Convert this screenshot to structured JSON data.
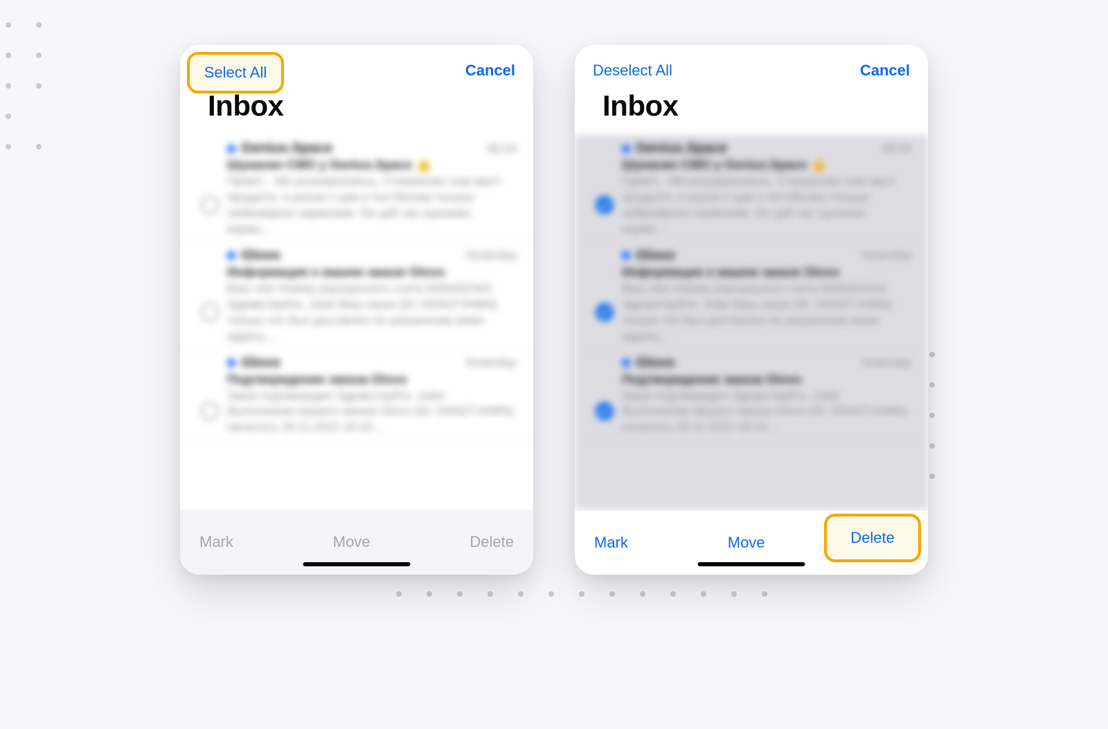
{
  "left": {
    "select_all": "Select All",
    "cancel": "Cancel",
    "title": "Inbox",
    "mark": "Mark",
    "move": "Move",
    "delete": "Delete",
    "emails": [
      {
        "sender": "Genius.Space",
        "time": "08:53",
        "subject": "Шукаємо CMO у Genius.Space 👍",
        "preview": "Привіт, . Ми розширюємось. Створюємо нові круті продукти, а разом з цим у постійному пошуку неймовірних керівників. На цей час шукаємо керівн…"
      },
      {
        "sender": "Glovo",
        "time": "Yesterday",
        "subject": "Информация о вашем заказе Glovo",
        "preview": "Ваш чек! Номер упрощенного счета 5005452343 Здравствуйте, Julia! Ваш заказ (ID: DDNZTJHMN) только что был доставлен по указанному вами адресу…"
      },
      {
        "sender": "Glovo",
        "time": "Yesterday",
        "subject": "Подтверждение заказа Glovo",
        "preview": "Заказ подтвержден Здравствуйте, Julia! Выполнение вашего заказа Glovo (ID: DDNZTJHMN) началось 29.11.2022 18:10…"
      }
    ]
  },
  "right": {
    "deselect_all": "Deselect All",
    "cancel": "Cancel",
    "title": "Inbox",
    "mark": "Mark",
    "move": "Move",
    "delete": "Delete",
    "emails": [
      {
        "sender": "Genius.Space",
        "time": "08:53",
        "subject": "Шукаємо CMO у Genius.Space 👍",
        "preview": "Привіт, . Ми розширюємось. Створюємо нові круті продукти, а разом з цим у постійному пошуку неймовірних керівників. На цей час шукаємо керівн…"
      },
      {
        "sender": "Glovo",
        "time": "Yesterday",
        "subject": "Информация о вашем заказе Glovo",
        "preview": "Ваш чек! Номер упрощенного счета 5005452343 Здравствуйте, Julia! Ваш заказ (ID: DDNZTJHMN) только что был доставлен по указанному вами адресу…"
      },
      {
        "sender": "Glovo",
        "time": "Yesterday",
        "subject": "Подтверждение заказа Glovo",
        "preview": "Заказ подтвержден Здравствуйте, Julia! Выполнение вашего заказа Glovo (ID: DDNZTJHMN) началось 29.11.2022 18:10…"
      }
    ]
  }
}
